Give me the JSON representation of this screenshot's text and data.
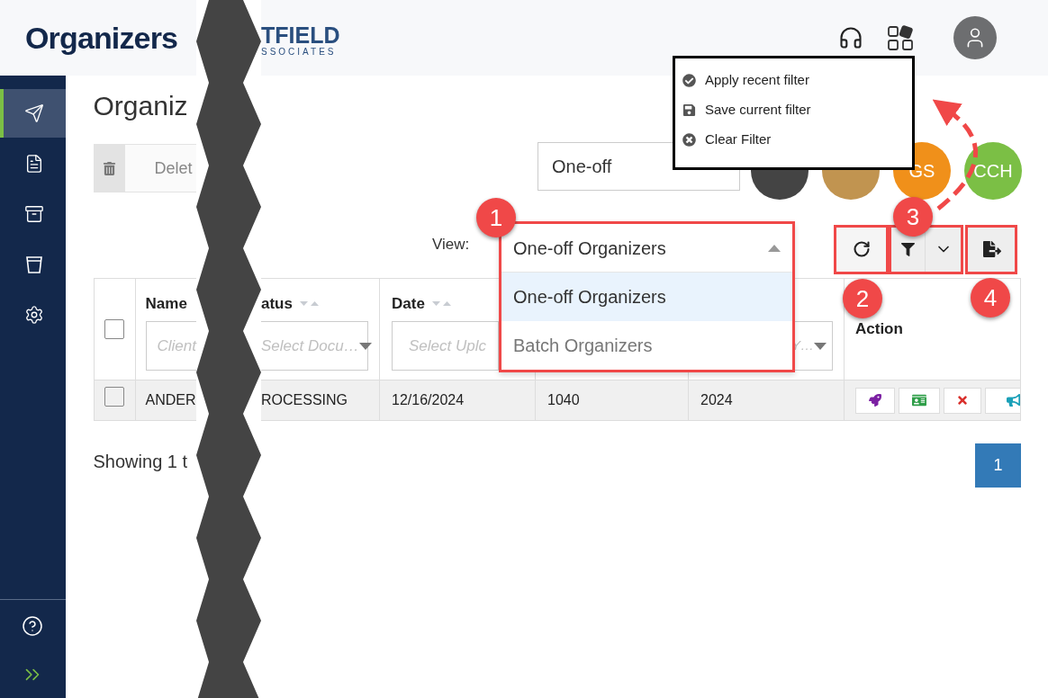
{
  "header": {
    "title": "Organizers",
    "logo_text": "TFIELD",
    "logo_subtext": "SSOCIATES"
  },
  "sidebar": {
    "items": [
      {
        "selected": true
      },
      {
        "selected": false
      },
      {
        "selected": false
      },
      {
        "selected": false
      },
      {
        "selected": false
      }
    ]
  },
  "page": {
    "title": "Organiz",
    "delete_button": "Delet",
    "type_field": "One-off"
  },
  "avatars": [
    {
      "color": "#444444"
    },
    {
      "color": "#c19450"
    },
    {
      "initials": "GS",
      "color": "#f0901a"
    },
    {
      "initials": "CCH",
      "color": "#7bbf45"
    }
  ],
  "filter_menu": {
    "items": [
      {
        "label": "Apply recent filter",
        "kind": "apply"
      },
      {
        "label": "Save current filter",
        "kind": "save"
      },
      {
        "label": "Clear Filter",
        "kind": "clear"
      }
    ]
  },
  "view": {
    "label": "View:",
    "value": "One-off Organizers",
    "options": [
      {
        "label": "One-off Organizers",
        "selected": true
      },
      {
        "label": "Batch Organizers",
        "selected": false
      }
    ]
  },
  "table": {
    "select_all_checked": false,
    "name_column": {
      "label": "Name",
      "filter_placeholder": "Client"
    },
    "status_column": {
      "label": "atus",
      "filter_placeholder": "Select Docu…"
    },
    "date_column": {
      "label": "Date",
      "filter_placeholder": "Select Uplc"
    },
    "column_5": {
      "filter_placeholder": "Y…"
    },
    "action_column": {
      "label": "Action"
    },
    "rows": [
      {
        "checked": false,
        "cells": [
          "ANDER",
          "ROCESSING",
          "12/16/2024",
          "1040",
          "2024"
        ]
      }
    ]
  },
  "footer_text": "Showing 1 t",
  "pagination": {
    "pages": [
      {
        "label": "1",
        "selected": true
      }
    ]
  },
  "annotations": [
    "1",
    "2",
    "3",
    "4"
  ]
}
